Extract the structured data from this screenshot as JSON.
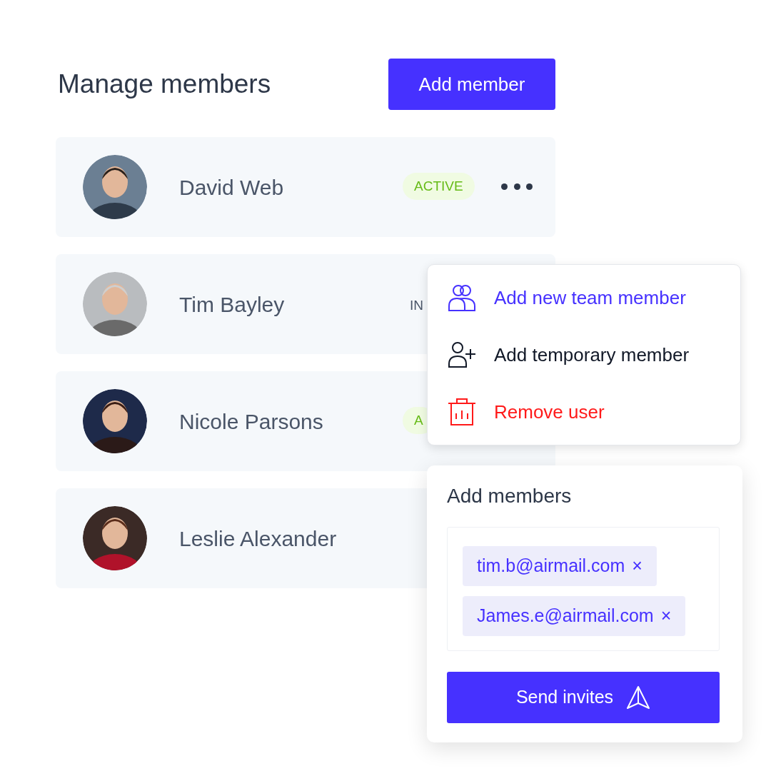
{
  "header": {
    "title": "Manage members",
    "button": "Add member"
  },
  "members": [
    {
      "name": "David Web",
      "status": "ACTIVE",
      "active": true,
      "has_menu": true
    },
    {
      "name": "Tim Bayley",
      "status": "IN",
      "active": false,
      "has_menu": false
    },
    {
      "name": "Nicole Parsons",
      "status": "A",
      "active": true,
      "has_menu": false
    },
    {
      "name": "Leslie Alexander",
      "has_menu": false
    }
  ],
  "menu": [
    {
      "kind": "team",
      "label": "Add new team member"
    },
    {
      "kind": "temporary",
      "label": "Add temporary member"
    },
    {
      "kind": "remove",
      "label": "Remove user"
    }
  ],
  "invite_panel": {
    "title": "Add members",
    "emails": [
      {
        "text": "tim.b@airmail.com",
        "remove": "×"
      },
      {
        "text": "James.e@airmail.com",
        "remove": "×"
      }
    ],
    "button": "Send invites"
  }
}
